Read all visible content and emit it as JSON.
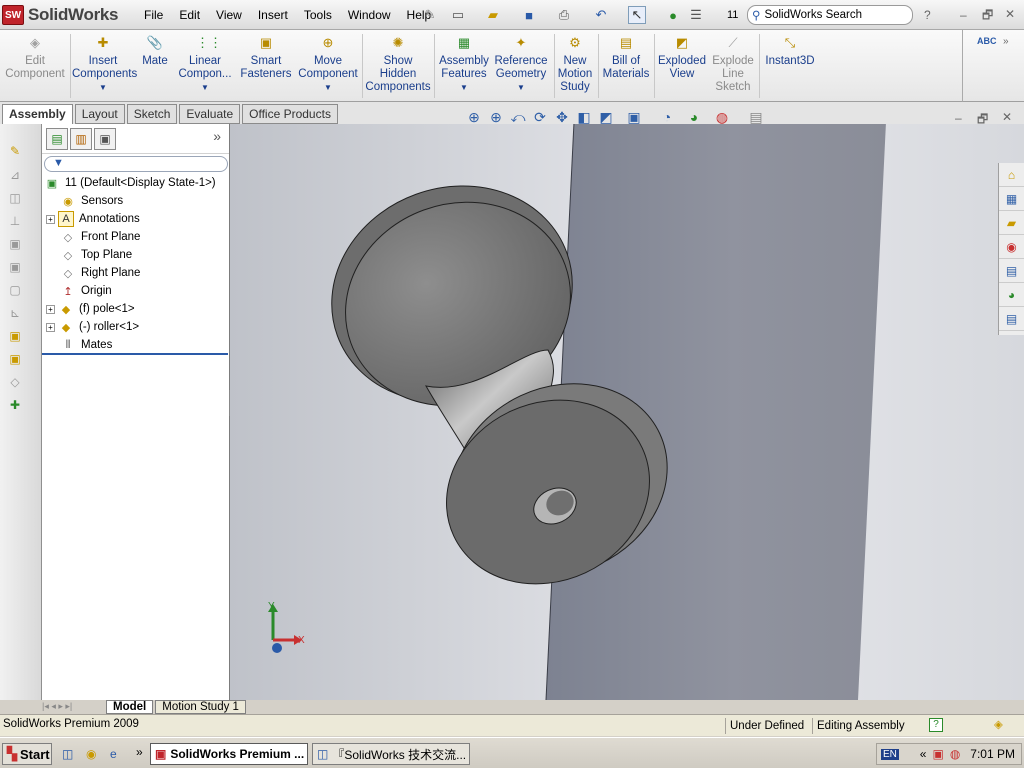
{
  "app": {
    "name": "SolidWorks",
    "logo_badge": "SW",
    "colors": {
      "brand": "#c0242b",
      "accent": "#2a5aa8",
      "tree_bar": "#2a5aa8"
    }
  },
  "menu": [
    "File",
    "Edit",
    "View",
    "Insert",
    "Tools",
    "Window",
    "Help"
  ],
  "toolbar": {
    "counter": "11",
    "search_placeholder": "SolidWorks Search",
    "help": "?",
    "window_controls": [
      "–",
      "🗗",
      "✕"
    ]
  },
  "command_manager": {
    "items": [
      {
        "label": "Edit\nComponent",
        "icon": "edit-component-icon",
        "enabled": false
      },
      {
        "label": "Insert\nComponents",
        "icon": "insert-components-icon",
        "enabled": true
      },
      {
        "label": "Mate",
        "icon": "mate-icon",
        "enabled": true
      },
      {
        "label": "Linear\nCompon...",
        "icon": "linear-pattern-icon",
        "enabled": true
      },
      {
        "label": "Smart\nFasteners",
        "icon": "smart-fasteners-icon",
        "enabled": true
      },
      {
        "label": "Move\nComponent",
        "icon": "move-component-icon",
        "enabled": true
      },
      {
        "label": "Show\nHidden\nComponents",
        "icon": "show-hidden-icon",
        "enabled": true
      },
      {
        "label": "Assembly\nFeatures",
        "icon": "assembly-features-icon",
        "enabled": true
      },
      {
        "label": "Reference\nGeometry",
        "icon": "reference-geometry-icon",
        "enabled": true
      },
      {
        "label": "New\nMotion\nStudy",
        "icon": "motion-study-icon",
        "enabled": true
      },
      {
        "label": "Bill of\nMaterials",
        "icon": "bom-icon",
        "enabled": true
      },
      {
        "label": "Exploded\nView",
        "icon": "exploded-view-icon",
        "enabled": true
      },
      {
        "label": "Explode\nLine\nSketch",
        "icon": "explode-line-icon",
        "enabled": false
      },
      {
        "label": "Instant3D",
        "icon": "instant3d-icon",
        "enabled": true
      }
    ],
    "spell_label": "ABC"
  },
  "tabs": [
    "Assembly",
    "Layout",
    "Sketch",
    "Evaluate",
    "Office Products"
  ],
  "active_tab": "Assembly",
  "feature_tree": {
    "filter_label": "▼",
    "root": "11  (Default<Display State-1>)",
    "items": [
      {
        "label": "Sensors",
        "icon": "sensors-icon",
        "expandable": false
      },
      {
        "label": "Annotations",
        "icon": "annotations-icon",
        "expandable": true
      },
      {
        "label": "Front Plane",
        "icon": "plane-icon",
        "expandable": false
      },
      {
        "label": "Top Plane",
        "icon": "plane-icon",
        "expandable": false
      },
      {
        "label": "Right Plane",
        "icon": "plane-icon",
        "expandable": false
      },
      {
        "label": "Origin",
        "icon": "origin-icon",
        "expandable": false
      },
      {
        "label": "(f) pole<1>",
        "icon": "part-icon",
        "expandable": true
      },
      {
        "label": "(-) roller<1>",
        "icon": "part-icon",
        "expandable": true
      },
      {
        "label": "Mates",
        "icon": "mates-icon",
        "expandable": false
      }
    ]
  },
  "bottom_tabs": [
    "Model",
    "Motion Study 1"
  ],
  "status": {
    "product": "SolidWorks Premium 2009",
    "state": "Under Defined",
    "mode": "Editing Assembly"
  },
  "taskbar": {
    "start": "Start",
    "tasks": [
      "SolidWorks Premium ...",
      "『SolidWorks 技术交流..."
    ],
    "lang": "EN",
    "time": "7:01 PM"
  },
  "triad": {
    "x_label": "X",
    "y_label": "Y"
  }
}
